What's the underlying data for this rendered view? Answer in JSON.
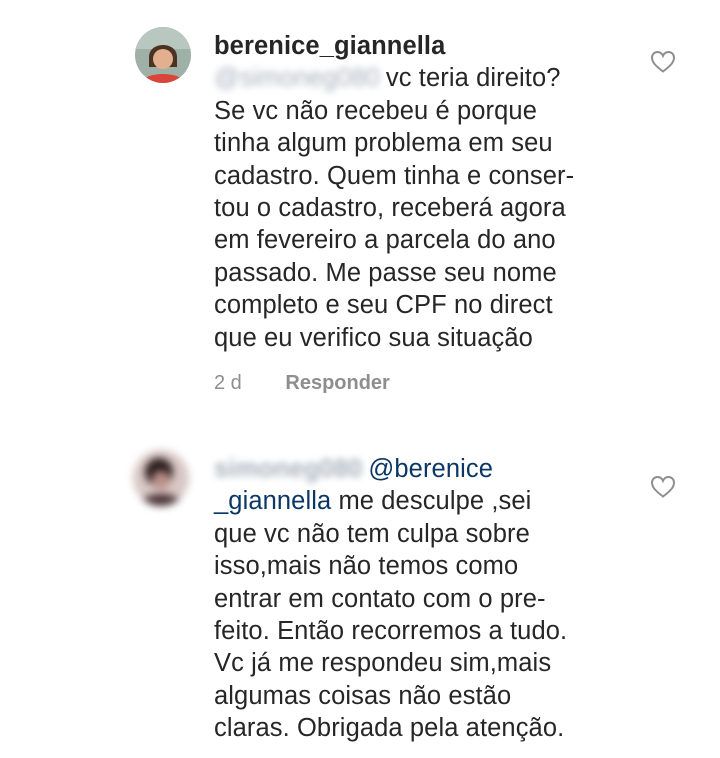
{
  "comments": [
    {
      "username": "berenice_giannella",
      "mention": "@simoneg080",
      "lines": [
        "vc teria direito?",
        "Se vc não recebeu é porque",
        "tinha algum problema em seu",
        "cadastro. Quem tinha e conser-",
        "tou o cadastro, receberá agora",
        "em fevereiro a parcela do ano",
        "passado. Me passe seu nome",
        "completo e seu CPF no direct",
        "que eu verifico sua situação"
      ],
      "time": "2 d",
      "reply_label": "Responder",
      "avatar_icon": "avatar-photo",
      "like_icon": "heart-outline-icon"
    },
    {
      "username": "simoneg080",
      "mention_part1": "@berenice",
      "mention_part2": "_giannella",
      "first_line_rest": "me desculpe ,sei",
      "lines": [
        "que vc não tem culpa sobre",
        "isso,mais não temos como",
        "entrar em contato com o pre-",
        "feito. Então recorremos a tudo.",
        "Vc já me respondeu sim,mais",
        "algumas coisas não estão",
        "claras. Obrigada pela atenção."
      ],
      "avatar_icon": "avatar-photo-blurred",
      "like_icon": "heart-outline-icon"
    }
  ],
  "colors": {
    "text": "#262626",
    "meta": "#8e8e8e",
    "mention": "#0b3766",
    "blurred_mention": "#8a97a6"
  }
}
